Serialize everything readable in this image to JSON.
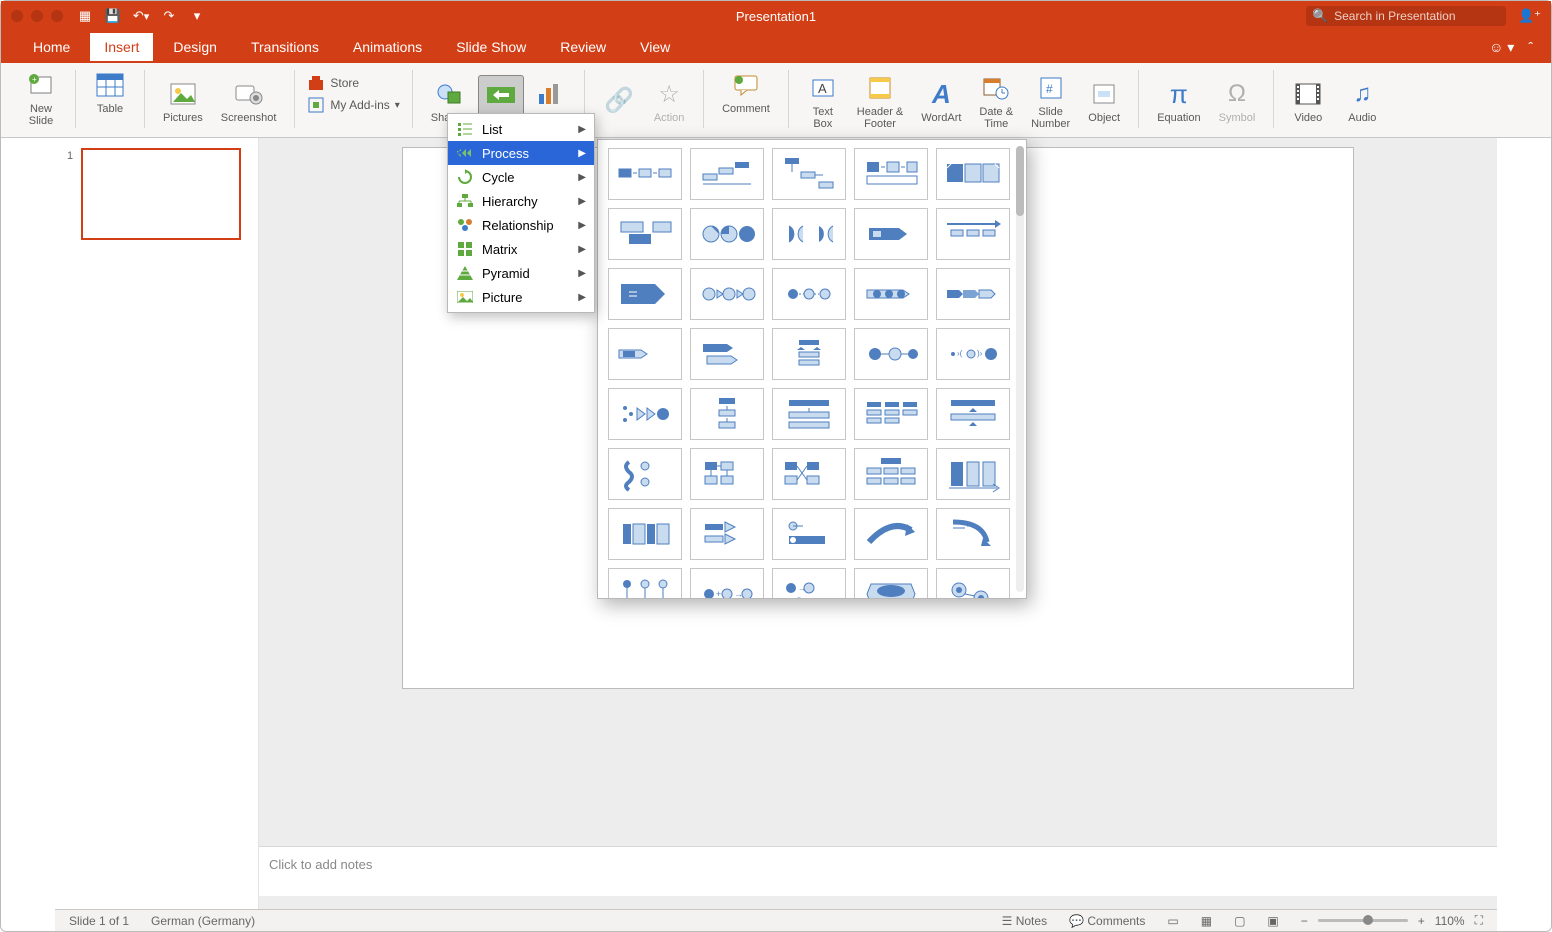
{
  "title": "Presentation1",
  "search_placeholder": "Search in Presentation",
  "tabs": [
    "Home",
    "Insert",
    "Design",
    "Transitions",
    "Animations",
    "Slide Show",
    "Review",
    "View"
  ],
  "active_tab": "Insert",
  "ribbon": {
    "new_slide": "New\nSlide",
    "table": "Table",
    "pictures": "Pictures",
    "screenshot": "Screenshot",
    "store": "Store",
    "myaddins": "My Add-ins",
    "shapes": "Shapes",
    "action": "Action",
    "comment": "Comment",
    "textbox": "Text\nBox",
    "header": "Header &\nFooter",
    "wordart": "WordArt",
    "datetime": "Date &\nTime",
    "slidenumber": "Slide\nNumber",
    "object": "Object",
    "equation": "Equation",
    "symbol": "Symbol",
    "video": "Video",
    "audio": "Audio"
  },
  "menu": [
    "List",
    "Process",
    "Cycle",
    "Hierarchy",
    "Relationship",
    "Matrix",
    "Pyramid",
    "Picture"
  ],
  "menu_selected": "Process",
  "thumb": {
    "num": "1"
  },
  "notes_placeholder": "Click to add notes",
  "status": {
    "slide": "Slide 1 of 1",
    "lang": "German (Germany)",
    "notes": "Notes",
    "comments": "Comments",
    "zoom": "110%"
  }
}
